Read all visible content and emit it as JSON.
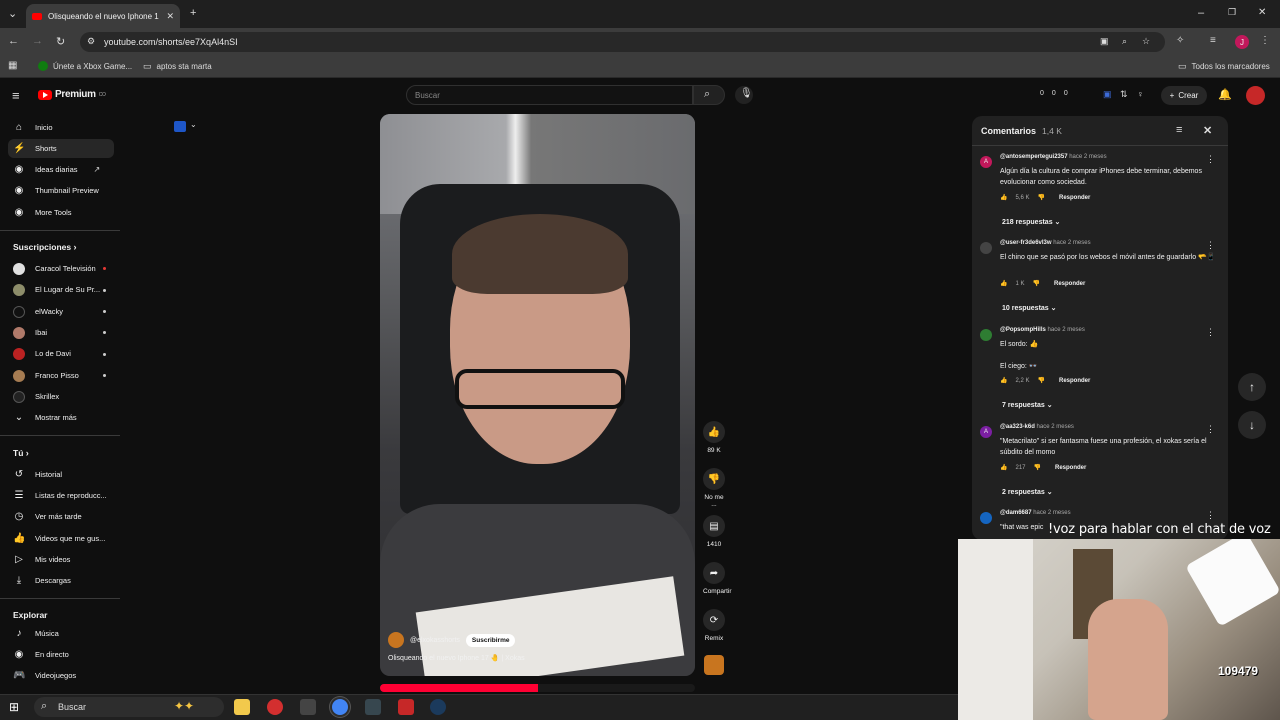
{
  "browser": {
    "tab_title": "Olisqueando el nuevo Iphone 1",
    "url": "youtube.com/shorts/ee7XqAl4nSI",
    "bookmarks": [
      "Únete a Xbox Game...",
      "aptos sta marta"
    ],
    "all_bookmarks": "Todos los marcadores",
    "profile_initial": "J"
  },
  "header": {
    "logo": "Premium",
    "logo_sup": "CO",
    "search_placeholder": "Buscar",
    "create_label": "Crear",
    "stats": [
      "0",
      "0",
      "0"
    ]
  },
  "sidebar": {
    "main": [
      "Inicio",
      "Shorts",
      "Ideas diarias",
      "Thumbnail Preview",
      "More Tools"
    ],
    "subs_heading": "Suscripciones",
    "subs": [
      "Caracol Televisión",
      "El Lugar de Su Pr...",
      "elWacky",
      "Ibai",
      "Lo de Davi",
      "Franco Pisso",
      "Skrillex",
      "Mostrar más"
    ],
    "you_heading": "Tú",
    "you": [
      "Historial",
      "Listas de reproducc...",
      "Ver más tarde",
      "Videos que me gus...",
      "Mis videos",
      "Descargas"
    ],
    "explore_heading": "Explorar",
    "explore": [
      "Música",
      "En directo",
      "Videojuegos"
    ]
  },
  "video": {
    "channel": "@elxokasshorts",
    "subscribe": "Suscribirme",
    "title": "Olisqueando el nuevo Iphone 17 🤚 | Xokas",
    "progress": 0.5
  },
  "actions": {
    "likes": "89 K",
    "dislike": "No me ...",
    "comments": "1410",
    "share": "Compartir",
    "remix": "Remix"
  },
  "comments": {
    "title": "Comentarios",
    "count": "1,4 K",
    "items": [
      {
        "author": "@antosempertegui2357",
        "time": "hace 2 meses",
        "text": "Algún día la cultura de comprar iPhones debe terminar, debemos evolucionar como sociedad.",
        "likes": "5,6 K",
        "reply": "Responder",
        "replies": "218 respuestas",
        "initial": "A",
        "color": "#c2185b"
      },
      {
        "author": "@user-fr3de6vl3w",
        "time": "hace 2 meses",
        "text": "El chino que se pasó por los webos el móvil antes de guardarlo 🫳📱",
        "likes": "1 K",
        "reply": "Responder",
        "replies": "10 respuestas",
        "initial": "",
        "color": "#444444"
      },
      {
        "author": "@PopsompHills",
        "time": "hace 2 meses",
        "text": "El sordo: 👍\n\nEl ciego: 👓",
        "likes": "2,2 K",
        "reply": "Responder",
        "replies": "7 respuestas",
        "initial": "",
        "color": "#2e7d32"
      },
      {
        "author": "@aa323-k6d",
        "time": "hace 2 meses",
        "text": "\"Metacrilato\" si ser fantasma fuese una profesión, el xokas sería el súbdito del momo",
        "likes": "217",
        "reply": "Responder",
        "replies": "2 respuestas",
        "initial": "A",
        "color": "#7b1fa2"
      },
      {
        "author": "@dam6687",
        "time": "hace 2 meses",
        "text": "\"that was epic",
        "likes": "",
        "reply": "",
        "replies": "",
        "initial": "",
        "color": "#1565c0"
      }
    ]
  },
  "overlay": {
    "text": "!voz para hablar con el chat de voz",
    "score": "109479"
  },
  "taskbar": {
    "search": "Buscar"
  }
}
